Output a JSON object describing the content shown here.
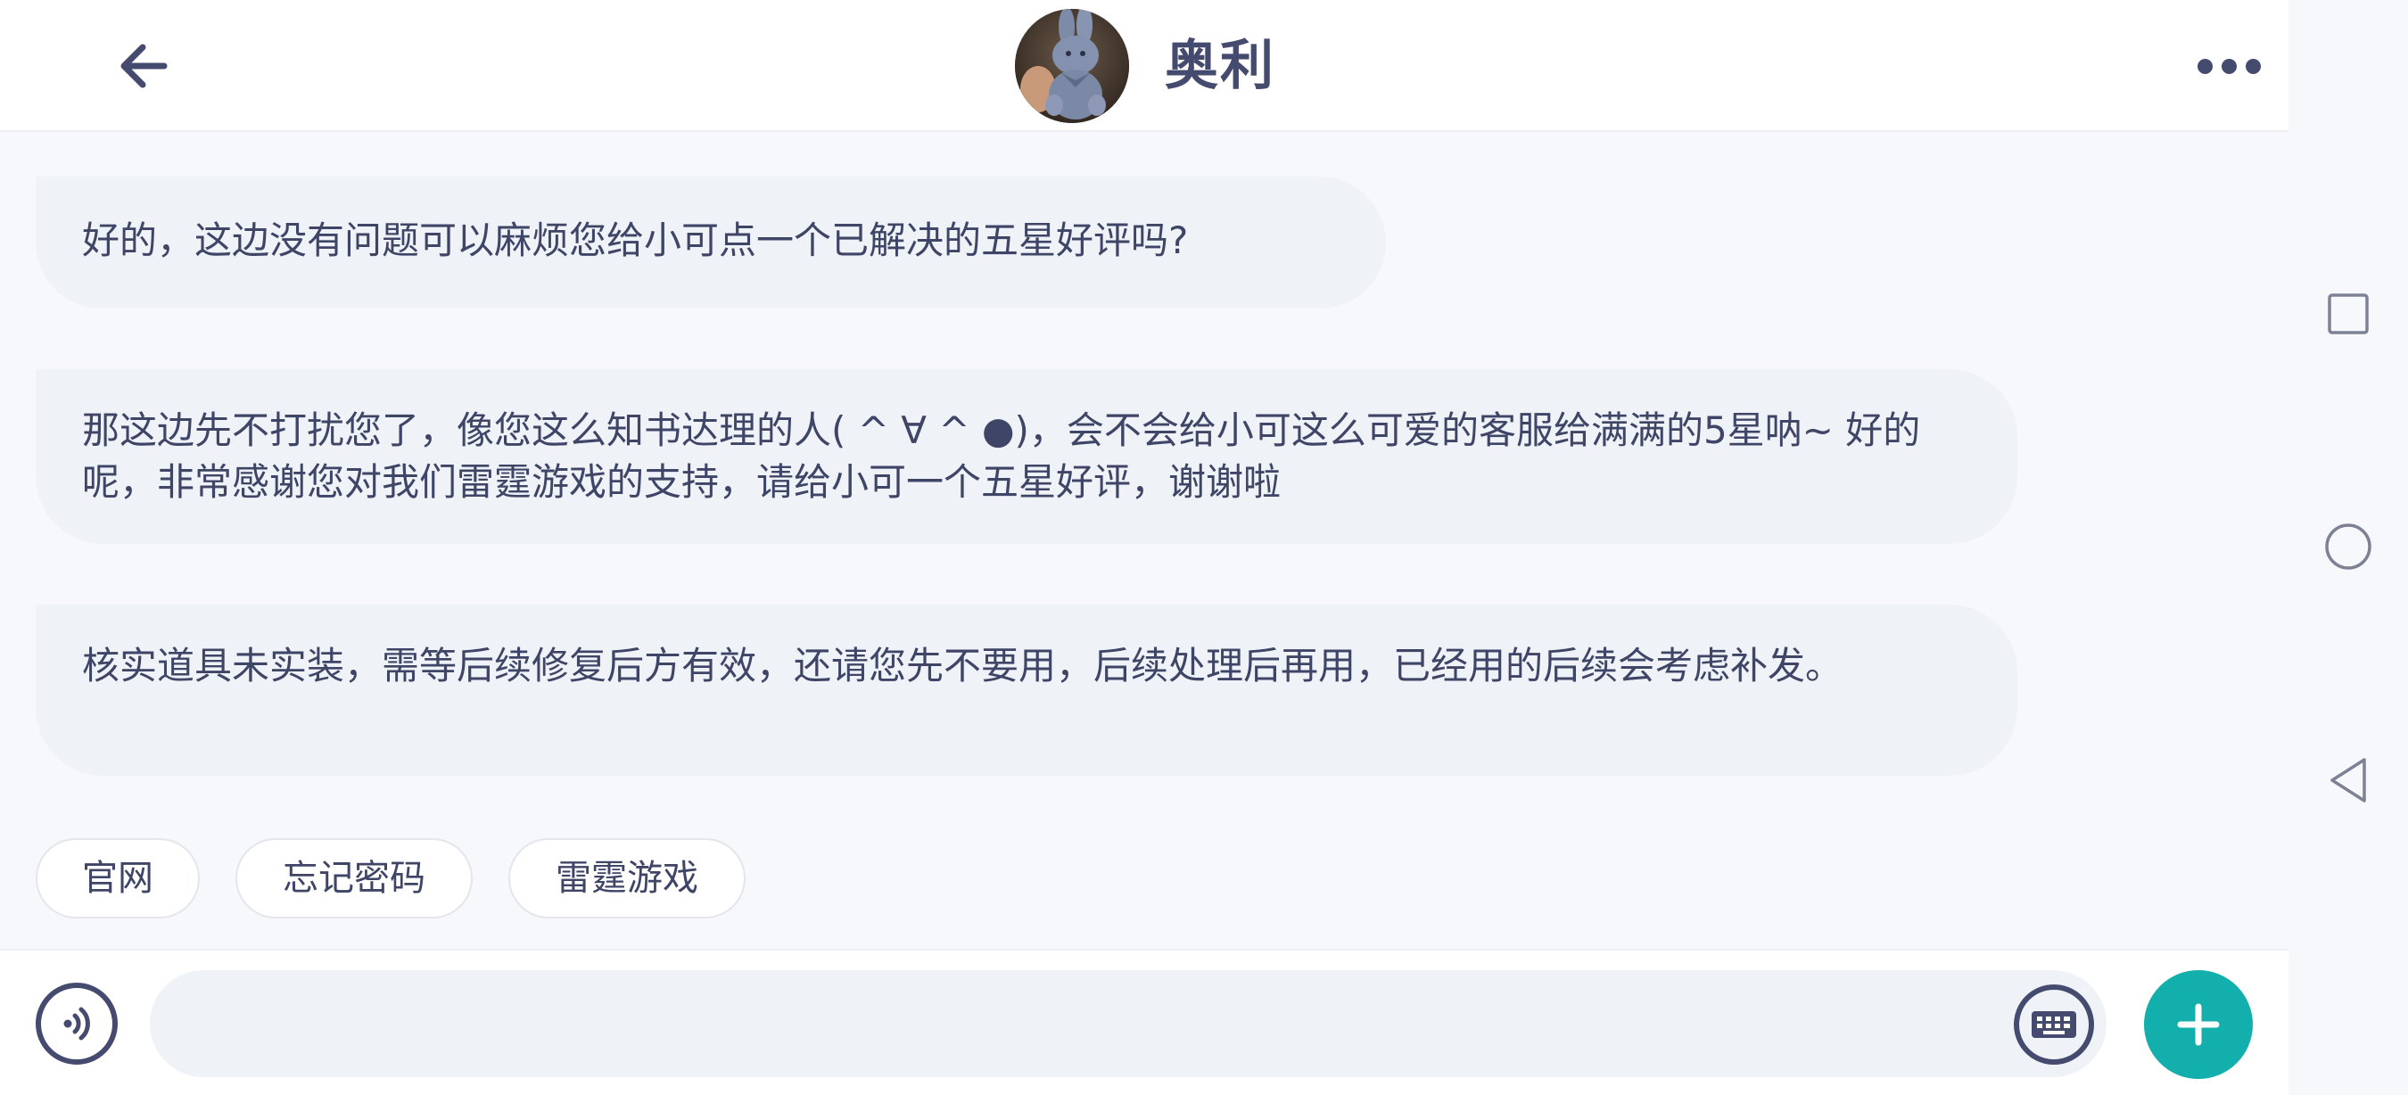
{
  "header": {
    "agent_name": "奥利",
    "icons": {
      "back": "arrow-left-icon",
      "more": "more-dots-icon",
      "avatar": "plush-bunny-avatar"
    }
  },
  "messages": [
    {
      "text": "好的，这边没有问题可以麻烦您给小可点一个已解决的五星好评吗?"
    },
    {
      "text": "那这边先不打扰您了，像您这么知书达理的人( ^ ∀ ^ ●)，会不会给小可这么可爱的客服给满满的5星呐~ 好的呢，非常感谢您对我们雷霆游戏的支持，请给小可一个五星好评，谢谢啦"
    },
    {
      "text": "核实道具未实装，需等后续修复后方有效，还请您先不要用，后续处理后再用，已经用的后续会考虑补发。"
    }
  ],
  "quick_replies": [
    {
      "label": "官网"
    },
    {
      "label": "忘记密码"
    },
    {
      "label": "雷霆游戏"
    }
  ],
  "input": {
    "value": "",
    "placeholder": "",
    "icons": {
      "voice": "voice-icon",
      "keyboard": "keyboard-icon",
      "plus": "plus-icon"
    }
  },
  "system_nav": {
    "icons": [
      "recent-apps-icon",
      "home-icon",
      "back-triangle-icon"
    ]
  },
  "colors": {
    "accent": "#12afac",
    "text": "#3f4566",
    "bubble": "#eff2f6",
    "background": "#f7f8fb"
  }
}
